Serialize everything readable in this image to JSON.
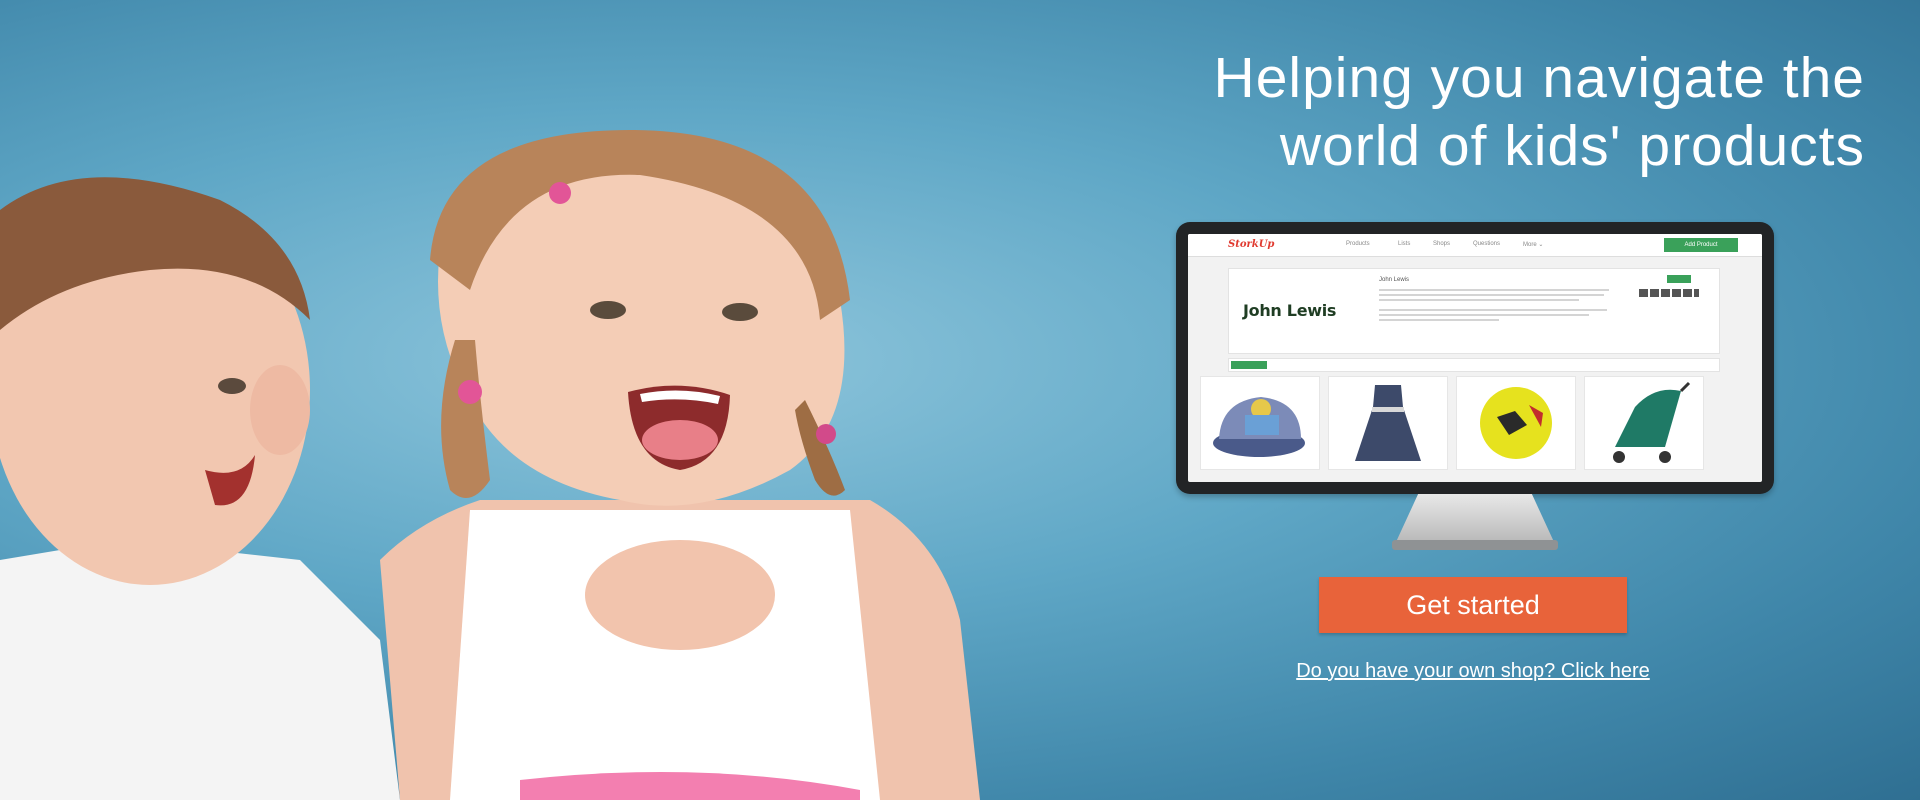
{
  "hero": {
    "headline_line1": "Helping you navigate the",
    "headline_line2": "world of kids' products",
    "cta_label": "Get started",
    "shop_link": "Do you have your own shop? Click here"
  },
  "mockup": {
    "logo": "StorkUp",
    "nav": [
      "Products",
      "Lists",
      "Shops",
      "Questions",
      "More ⌄"
    ],
    "add_button": "Add Product",
    "brand": "John Lewis",
    "shop_name": "John Lewis",
    "products": [
      "car-seat",
      "dress",
      "football",
      "pushchair"
    ]
  },
  "colors": {
    "cta": "#e8633a",
    "brand_green": "#3aa15a",
    "logo_red": "#e0392f"
  }
}
